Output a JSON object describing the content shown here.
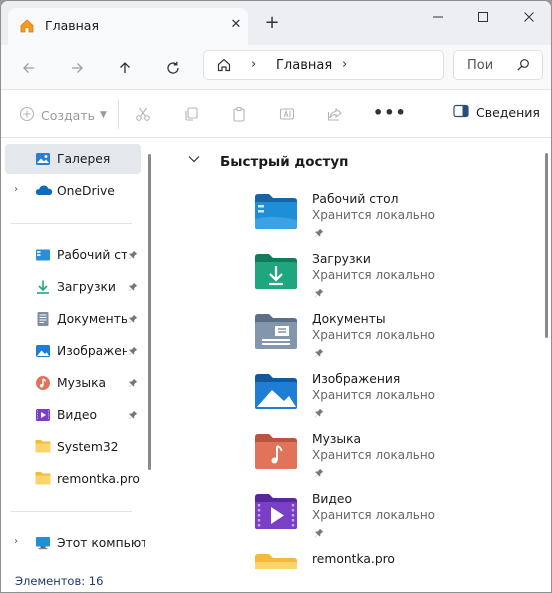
{
  "tab": {
    "title": "Главная",
    "icon": "home-icon"
  },
  "window_controls": {
    "new_tab": "+",
    "minimize": "—",
    "maximize": "☐",
    "close": "✕"
  },
  "address": {
    "crumb": "Главная"
  },
  "search": {
    "placeholder": "Пои"
  },
  "toolbar": {
    "create_label": "Создать",
    "details_label": "Сведения"
  },
  "sidebar": {
    "gallery": "Галерея",
    "onedrive": "OneDrive",
    "items": [
      {
        "label": "Рабочий стол",
        "icon": "desktop-icon",
        "pinned": true
      },
      {
        "label": "Загрузки",
        "icon": "download-icon",
        "pinned": true
      },
      {
        "label": "Документы",
        "icon": "documents-icon",
        "pinned": true
      },
      {
        "label": "Изображения",
        "icon": "pictures-icon",
        "pinned": true
      },
      {
        "label": "Музыка",
        "icon": "music-icon",
        "pinned": true
      },
      {
        "label": "Видео",
        "icon": "video-icon",
        "pinned": true
      },
      {
        "label": "System32",
        "icon": "folder-icon",
        "pinned": false
      },
      {
        "label": "remontka.pro",
        "icon": "folder-icon",
        "pinned": false
      }
    ],
    "this_pc": "Этот компьютер"
  },
  "main": {
    "section_title": "Быстрый доступ",
    "items": [
      {
        "name": "Рабочий стол",
        "sub": "Хранится локально"
      },
      {
        "name": "Загрузки",
        "sub": "Хранится локально"
      },
      {
        "name": "Документы",
        "sub": "Хранится локально"
      },
      {
        "name": "Изображения",
        "sub": "Хранится локально"
      },
      {
        "name": "Музыка",
        "sub": "Хранится локально"
      },
      {
        "name": "Видео",
        "sub": "Хранится локально"
      },
      {
        "name": "remontka.pro",
        "sub": ""
      }
    ]
  },
  "status": {
    "text": "Элементов: 16"
  },
  "colors": {
    "accent": "#0067c0",
    "folder_yellow": "#f4b93d",
    "desktop_blue": "#1e8fd6",
    "downloads_green": "#1fa67e",
    "docs_gray": "#8496ab",
    "music_orange": "#e0735a",
    "video_purple": "#7a3fc4"
  }
}
